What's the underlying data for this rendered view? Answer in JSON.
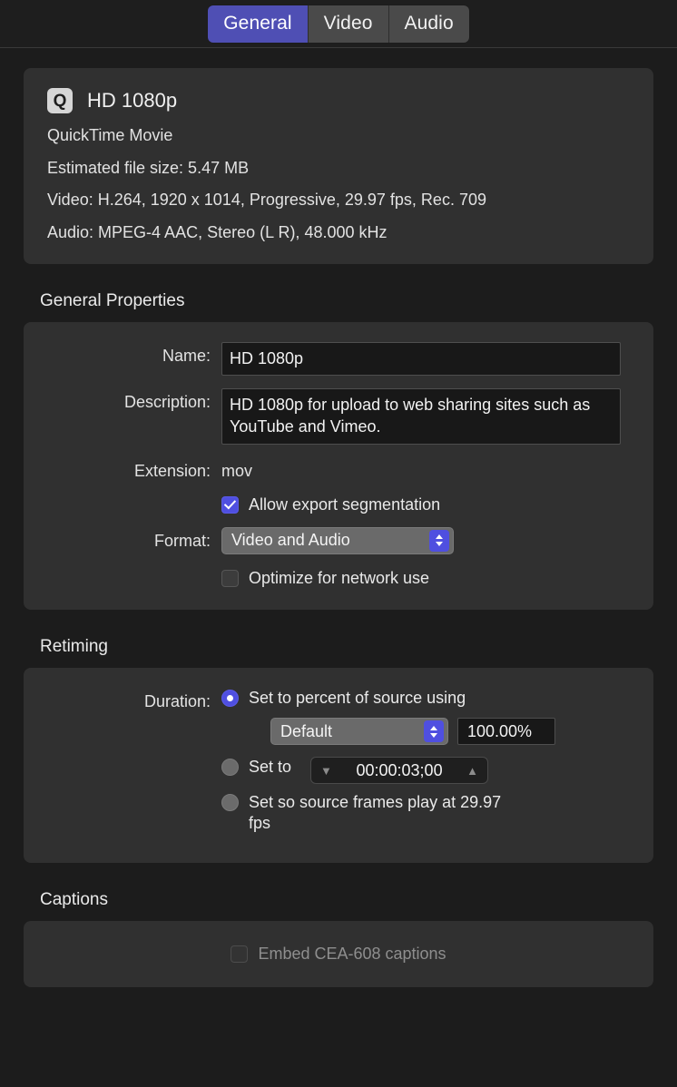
{
  "tabs": [
    {
      "label": "General",
      "active": true
    },
    {
      "label": "Video",
      "active": false
    },
    {
      "label": "Audio",
      "active": false
    }
  ],
  "summary": {
    "icon": "quicktime-icon",
    "icon_glyph": "Q",
    "title": "HD 1080p",
    "lines": [
      "QuickTime Movie",
      "Estimated file size: 5.47 MB",
      "Video: H.264, 1920 x 1014, Progressive, 29.97 fps, Rec. 709",
      "Audio: MPEG-4 AAC, Stereo (L R), 48.000 kHz"
    ]
  },
  "general_properties": {
    "section_title": "General Properties",
    "name_label": "Name:",
    "name_value": "HD 1080p",
    "description_label": "Description:",
    "description_value": "HD 1080p for upload to web sharing sites such as YouTube and Vimeo.",
    "extension_label": "Extension:",
    "extension_value": "mov",
    "allow_segmentation_label": "Allow export segmentation",
    "allow_segmentation_checked": true,
    "format_label": "Format:",
    "format_value": "Video and Audio",
    "optimize_label": "Optimize for network use",
    "optimize_checked": false
  },
  "retiming": {
    "section_title": "Retiming",
    "duration_label": "Duration:",
    "option_percent_label": "Set to percent of source using",
    "option_percent_selected": true,
    "rate_value": "Default",
    "percent_value": "100.00%",
    "option_setto_label": "Set to",
    "option_setto_selected": false,
    "timecode_value": "00:00:03;00",
    "option_frames_label": "Set so source frames play at 29.97 fps",
    "option_frames_selected": false
  },
  "captions": {
    "section_title": "Captions",
    "embed_label": "Embed CEA-608 captions",
    "embed_checked": false,
    "disabled": true
  },
  "colors": {
    "accent": "#4f4fe0",
    "tab_active": "#4f4fb4",
    "page_bg": "#1c1c1c",
    "card_bg": "#303030",
    "field_bg": "#181818"
  }
}
